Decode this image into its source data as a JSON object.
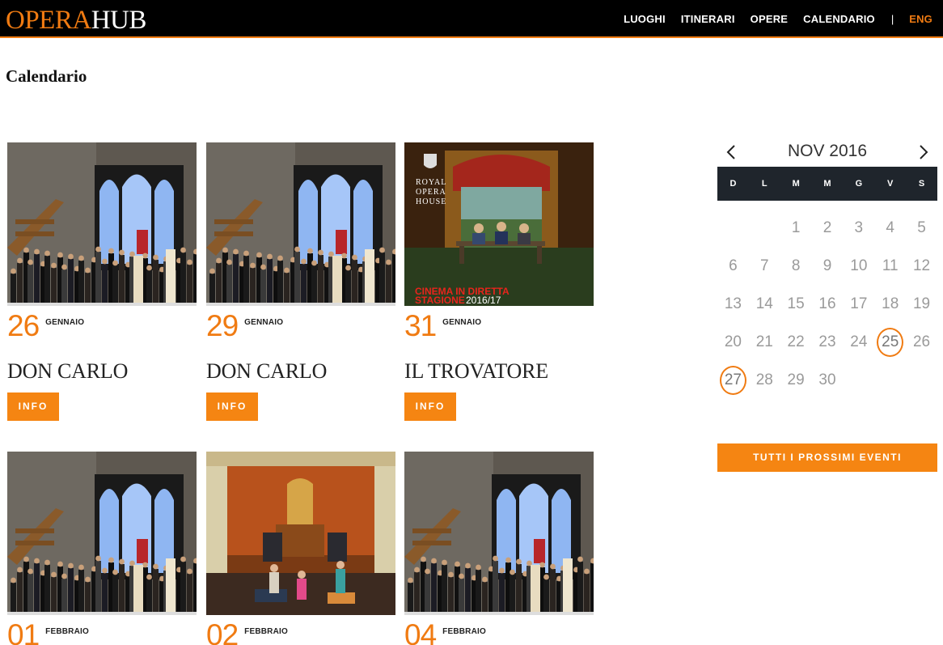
{
  "header": {
    "logo_part1": "OPERA",
    "logo_part2": "HUB",
    "nav": [
      "LUOGHI",
      "ITINERARI",
      "OPERE",
      "CALENDARIO"
    ],
    "separator": "|",
    "lang": "ENG"
  },
  "page": {
    "title": "Calendario"
  },
  "events": [
    {
      "day": "26",
      "month": "GENNAIO",
      "title": "DON CARLO",
      "button": "INFO",
      "image": "don-carlo"
    },
    {
      "day": "29",
      "month": "GENNAIO",
      "title": "DON CARLO",
      "button": "INFO",
      "image": "don-carlo"
    },
    {
      "day": "31",
      "month": "GENNAIO",
      "title": "IL TROVATORE",
      "button": "INFO",
      "image": "il-trovatore"
    },
    {
      "day": "01",
      "month": "FEBBRAIO",
      "title": "",
      "button": "",
      "image": "don-carlo"
    },
    {
      "day": "02",
      "month": "FEBBRAIO",
      "title": "",
      "button": "",
      "image": "stage-palace"
    },
    {
      "day": "04",
      "month": "FEBBRAIO",
      "title": "",
      "button": "",
      "image": "don-carlo"
    }
  ],
  "poster": {
    "line1": "ROYAL",
    "line2": "OPERA",
    "line3": "HOUSE",
    "cinema": "CINEMA IN DIRETTA",
    "season_label": "STAGIONE",
    "season_years": "2016/17"
  },
  "calendar": {
    "month_label": "NOV 2016",
    "weekdays": [
      "D",
      "L",
      "M",
      "M",
      "G",
      "V",
      "S"
    ],
    "first_weekday_index": 2,
    "days_in_month": 30,
    "event_days": [
      25,
      27
    ],
    "prev_icon": "chevron-left-icon",
    "next_icon": "chevron-right-icon"
  },
  "all_events_label": "TUTTI I PROSSIMI EVENTI",
  "colors": {
    "accent": "#f07b12",
    "header_bg": "#000000",
    "weekday_bar": "#1f252c"
  }
}
